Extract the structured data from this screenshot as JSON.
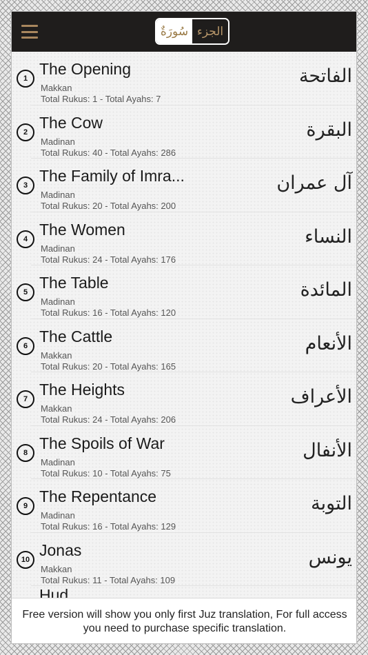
{
  "header": {
    "menu_icon": "hamburger-menu-icon",
    "segment": {
      "surah_label": "سُورَةٌ",
      "juz_label": "الجزء"
    }
  },
  "surahs": [
    {
      "number": "1",
      "name": "The Opening",
      "type": "Makkan",
      "stats": "Total Rukus: 1 - Total Ayahs: 7",
      "arabic": "الفاتحة"
    },
    {
      "number": "2",
      "name": "The Cow",
      "type": "Madinan",
      "stats": "Total Rukus: 40 - Total Ayahs: 286",
      "arabic": "البقرة"
    },
    {
      "number": "3",
      "name": "The Family of Imra...",
      "type": "Madinan",
      "stats": "Total Rukus: 20 - Total Ayahs: 200",
      "arabic": "آل عمران"
    },
    {
      "number": "4",
      "name": "The Women",
      "type": "Madinan",
      "stats": "Total Rukus: 24 - Total Ayahs: 176",
      "arabic": "النساء"
    },
    {
      "number": "5",
      "name": "The Table",
      "type": "Madinan",
      "stats": "Total Rukus: 16 - Total Ayahs: 120",
      "arabic": "المائدة"
    },
    {
      "number": "6",
      "name": "The Cattle",
      "type": "Makkan",
      "stats": "Total Rukus: 20 - Total Ayahs: 165",
      "arabic": "الأنعام"
    },
    {
      "number": "7",
      "name": "The Heights",
      "type": "Makkan",
      "stats": "Total Rukus: 24 - Total Ayahs: 206",
      "arabic": "الأعراف"
    },
    {
      "number": "8",
      "name": "The Spoils of War",
      "type": "Madinan",
      "stats": "Total Rukus: 10 - Total Ayahs: 75",
      "arabic": "الأنفال"
    },
    {
      "number": "9",
      "name": "The Repentance",
      "type": "Madinan",
      "stats": "Total Rukus: 16 - Total Ayahs: 129",
      "arabic": "التوبة"
    },
    {
      "number": "10",
      "name": "Jonas",
      "type": "Makkan",
      "stats": "Total Rukus: 11 - Total Ayahs: 109",
      "arabic": "يونس"
    }
  ],
  "partial_next": "Hud",
  "footer": {
    "notice": "Free version will show you only first Juz translation, For full access you need to purchase specific translation."
  }
}
